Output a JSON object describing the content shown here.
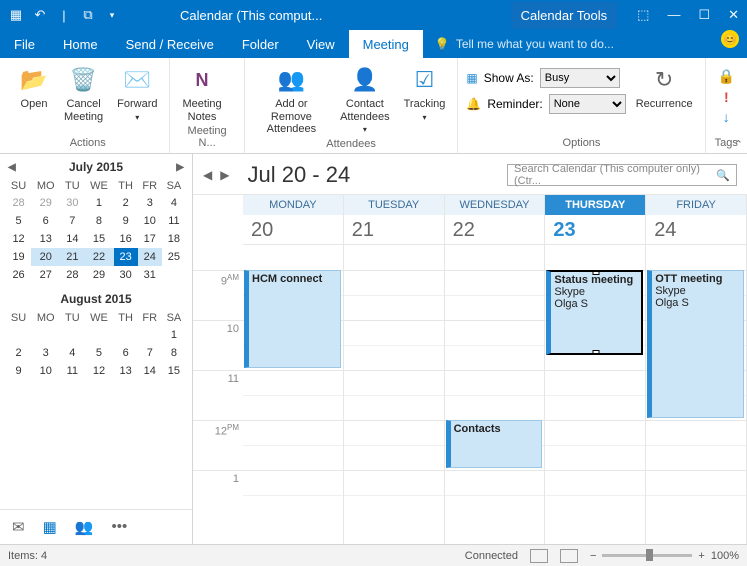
{
  "titlebar": {
    "title": "Calendar (This comput...",
    "contextTab": "Calendar Tools"
  },
  "menu": {
    "file": "File",
    "home": "Home",
    "sendreceive": "Send / Receive",
    "folder": "Folder",
    "view": "View",
    "meeting": "Meeting",
    "tell": "Tell me what you want to do..."
  },
  "ribbon": {
    "open": "Open",
    "cancel": "Cancel\nMeeting",
    "forward": "Forward",
    "actions": "Actions",
    "notes": "Meeting\nNotes",
    "notesGroup": "Meeting N...",
    "addremove": "Add or Remove\nAttendees",
    "contact": "Contact\nAttendees",
    "tracking": "Tracking",
    "attendees": "Attendees",
    "showas": "Show As:",
    "reminder": "Reminder:",
    "busy": "Busy",
    "none": "None",
    "recurrence": "Recurrence",
    "options": "Options",
    "tags": "Tags"
  },
  "sidebar": {
    "month1": "July 2015",
    "month2": "August 2015",
    "dow": [
      "SU",
      "MO",
      "TU",
      "WE",
      "TH",
      "FR",
      "SA"
    ],
    "jul": [
      [
        "28",
        "29",
        "30",
        "1",
        "2",
        "3",
        "4"
      ],
      [
        "5",
        "6",
        "7",
        "8",
        "9",
        "10",
        "11"
      ],
      [
        "12",
        "13",
        "14",
        "15",
        "16",
        "17",
        "18"
      ],
      [
        "19",
        "20",
        "21",
        "22",
        "23",
        "24",
        "25"
      ],
      [
        "26",
        "27",
        "28",
        "29",
        "30",
        "31",
        ""
      ]
    ],
    "aug": [
      [
        "",
        "",
        "",
        "",
        "",
        "",
        "1"
      ],
      [
        "2",
        "3",
        "4",
        "5",
        "6",
        "7",
        "8"
      ],
      [
        "9",
        "10",
        "11",
        "12",
        "13",
        "14",
        "15"
      ]
    ]
  },
  "main": {
    "range": "Jul 20 - 24",
    "search": "Search Calendar (This computer only) (Ctr...",
    "days": [
      "MONDAY",
      "TUESDAY",
      "WEDNESDAY",
      "THURSDAY",
      "FRIDAY"
    ],
    "nums": [
      "20",
      "21",
      "22",
      "23",
      "24"
    ],
    "hours": [
      {
        "h": "9",
        "ap": "AM"
      },
      {
        "h": "10",
        "ap": ""
      },
      {
        "h": "11",
        "ap": ""
      },
      {
        "h": "12",
        "ap": "PM"
      },
      {
        "h": "1",
        "ap": ""
      }
    ]
  },
  "appts": {
    "hcm": {
      "title": "HCM connect"
    },
    "contacts": {
      "title": "Contacts"
    },
    "status": {
      "title": "Status meeting",
      "loc": "Skype",
      "org": "Olga S"
    },
    "ott": {
      "title": "OTT meeting",
      "loc": "Skype",
      "org": "Olga S"
    }
  },
  "statusbar": {
    "items": "Items: 4",
    "connected": "Connected",
    "zoom": "100%"
  }
}
